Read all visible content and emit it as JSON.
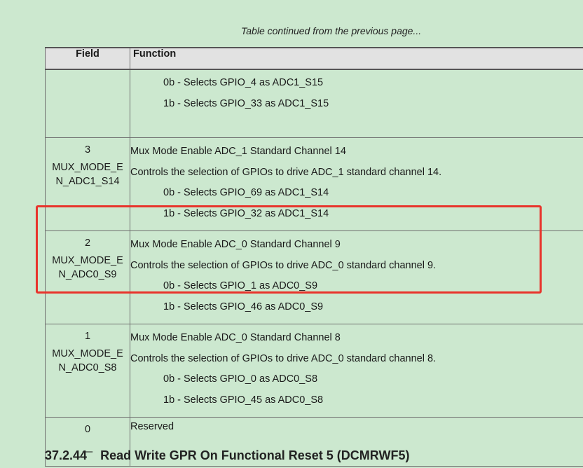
{
  "continued_note": "Table continued from the previous page...",
  "table": {
    "header": {
      "field": "Field",
      "function": "Function"
    },
    "rows": [
      {
        "field_num": "",
        "field_name": "",
        "function_lines": [],
        "options": [
          "0b - Selects GPIO_4 as ADC1_S15",
          "1b - Selects GPIO_33 as ADC1_S15"
        ]
      },
      {
        "field_num": "3",
        "field_name": "MUX_MODE_EN_ADC1_S14",
        "function_lines": [
          "Mux Mode Enable ADC_1 Standard Channel 14",
          "Controls the selection of GPIOs to drive ADC_1 standard channel 14."
        ],
        "options": [
          "0b - Selects GPIO_69 as ADC1_S14",
          "1b - Selects GPIO_32 as ADC1_S14"
        ]
      },
      {
        "field_num": "2",
        "field_name": "MUX_MODE_EN_ADC0_S9",
        "function_lines": [
          "Mux Mode Enable ADC_0 Standard Channel 9",
          "Controls the selection of GPIOs to drive ADC_0 standard channel 9."
        ],
        "options": [
          "0b - Selects GPIO_1 as ADC0_S9",
          "1b - Selects GPIO_46 as ADC0_S9"
        ]
      },
      {
        "field_num": "1",
        "field_name": "MUX_MODE_EN_ADC0_S8",
        "function_lines": [
          "Mux Mode Enable ADC_0 Standard Channel 8",
          "Controls the selection of GPIOs to drive ADC_0 standard channel 8."
        ],
        "options": [
          "0b - Selects GPIO_0 as ADC0_S8",
          "1b - Selects GPIO_45 as ADC0_S8"
        ]
      },
      {
        "field_num": "0",
        "field_name": "—",
        "function_lines": [
          "Reserved"
        ],
        "options": []
      }
    ]
  },
  "highlight_color": "#e8332b",
  "section_heading": {
    "number": "37.2.44",
    "title": "Read Write GPR On Functional Reset 5 (DCMRWF5)"
  }
}
